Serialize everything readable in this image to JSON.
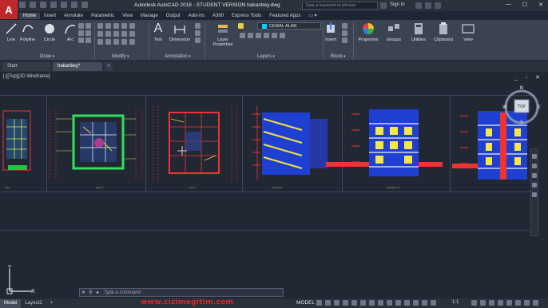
{
  "window": {
    "title": "Autodesk AutoCAD 2018 - STUDENT VERSION    hakanbey.dwg",
    "logo_letter": "A",
    "search_placeholder": "Type a keyword or phrase",
    "signin": "Sign In"
  },
  "ribbon_tabs": [
    "Home",
    "Insert",
    "Annotate",
    "Parametric",
    "View",
    "Manage",
    "Output",
    "Add-ins",
    "A360",
    "Express Tools",
    "Featured Apps"
  ],
  "ribbon": {
    "draw": {
      "label": "Draw",
      "buttons": [
        "Line",
        "Polyline",
        "Circle",
        "Arc"
      ]
    },
    "modify": {
      "label": "Modify"
    },
    "annotation": {
      "label": "Annotation",
      "buttons": [
        "Text",
        "Dimension"
      ]
    },
    "layers": {
      "label": "Layers",
      "button": "Layer Properties",
      "current_layer": "CEMAL ALAN"
    },
    "block": {
      "label": "Block",
      "button": "Insert"
    },
    "properties_label": "Properties",
    "groups_label": "Groups",
    "utilities_label": "Utilities",
    "clipboard_label": "Clipboard",
    "view_label": "View"
  },
  "file_tabs": [
    "Start",
    "hakanbey*"
  ],
  "viewport": {
    "label": "[-][Top][2D Wireframe]",
    "viewcube": {
      "top": "TOP",
      "n": "N",
      "s": "S",
      "e": "E",
      "w": "W"
    },
    "ucs": {
      "x": "X",
      "y": "Y"
    }
  },
  "command": {
    "placeholder": "Type a command"
  },
  "status": {
    "tabs": [
      "Model",
      "Layout2"
    ],
    "mode": "MODEL",
    "scale": "1:1",
    "watermark": "www.cizimegitim.com"
  },
  "colors": {
    "accent": "#c0282c",
    "background": "#212834",
    "ribbon": "#3b4250"
  }
}
